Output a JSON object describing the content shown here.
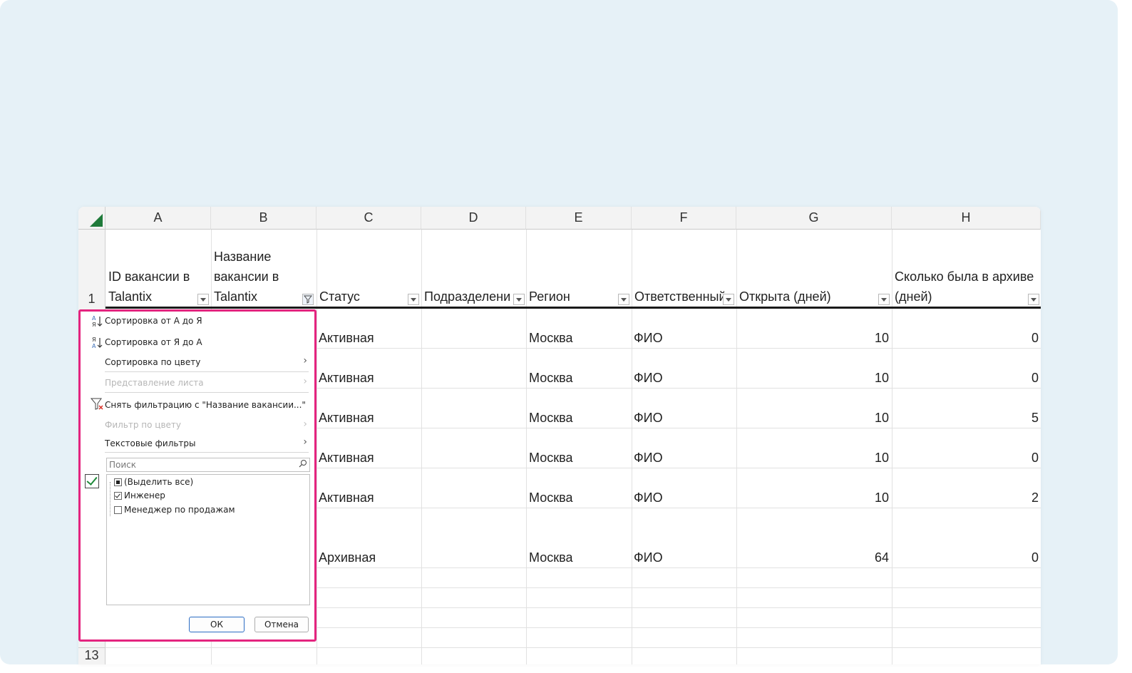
{
  "columns": [
    "A",
    "B",
    "C",
    "D",
    "E",
    "F",
    "G",
    "H"
  ],
  "row_numbers": {
    "header": "1",
    "last": "13"
  },
  "headers": [
    "ID вакансии в\nTalantix",
    "Название\nвакансии в\nTalantix",
    "Статус",
    "Подразделени",
    "Регион",
    "Ответственный",
    "Открыта (дней)",
    "Сколько была в архиве\n(дней)"
  ],
  "rows": [
    {
      "status": "Активная",
      "region": "Москва",
      "owner": "ФИО",
      "open_days": "10",
      "archive_days": "0"
    },
    {
      "status": "Активная",
      "region": "Москва",
      "owner": "ФИО",
      "open_days": "10",
      "archive_days": "0"
    },
    {
      "status": "Активная",
      "region": "Москва",
      "owner": "ФИО",
      "open_days": "10",
      "archive_days": "5"
    },
    {
      "status": "Активная",
      "region": "Москва",
      "owner": "ФИО",
      "open_days": "10",
      "archive_days": "0"
    },
    {
      "status": "Активная",
      "region": "Москва",
      "owner": "ФИО",
      "open_days": "10",
      "archive_days": "2"
    },
    {
      "status": "Архивная",
      "region": "Москва",
      "owner": "ФИО",
      "open_days": "64",
      "archive_days": "0"
    }
  ],
  "filter_menu": {
    "sort_asc": "Сортировка от А до Я",
    "sort_desc": "Сортировка от Я до А",
    "sort_by_color": "Сортировка по цвету",
    "sheet_view": "Представление листа",
    "clear_filter": "Снять фильтрацию с \"Название вакансии...\"",
    "filter_by_color": "Фильтр по цвету",
    "text_filters": "Текстовые фильтры",
    "search_placeholder": "Поиск",
    "items": [
      "(Выделить все)",
      "Инженер",
      "Менеджер по продажам"
    ],
    "ok": "ОК",
    "cancel": "Отмена"
  },
  "colors": {
    "accent": "#e4247f",
    "excel_green": "#1f7a3a",
    "ok_border": "#2b6cc4"
  }
}
